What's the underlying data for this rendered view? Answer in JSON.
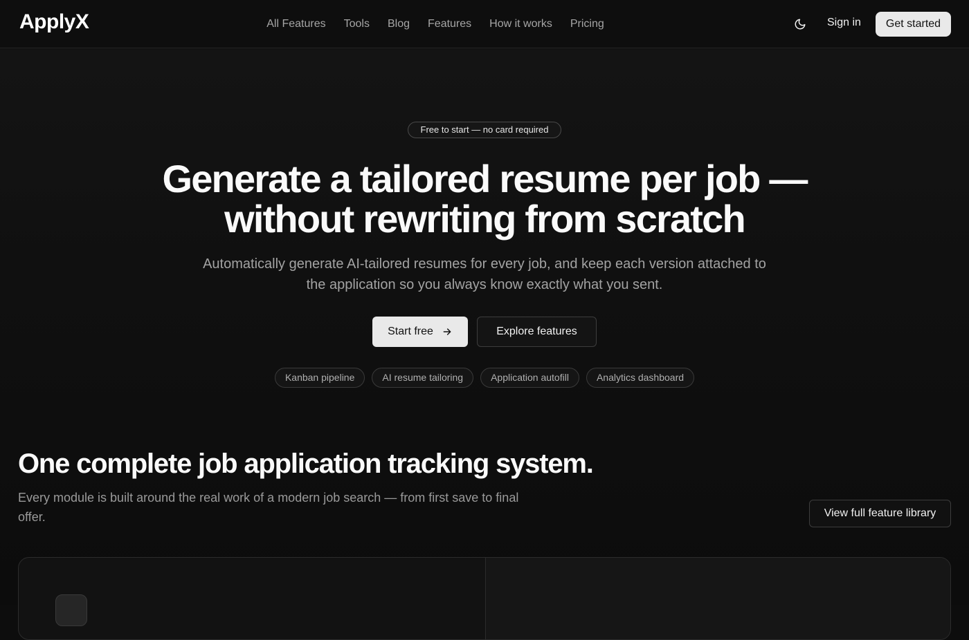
{
  "nav": {
    "logo": "ApplyX",
    "links": [
      "All Features",
      "Tools",
      "Blog",
      "Features",
      "How it works",
      "Pricing"
    ],
    "theme_icon": "moon-icon",
    "signin": "Sign in",
    "cta": "Get started"
  },
  "hero": {
    "badge": "Free to start — no card required",
    "title": "Generate a tailored resume per job — without rewriting from scratch",
    "subtitle": "Automatically generate AI-tailored resumes for every job, and keep each version attached to the application so you always know exactly what you sent.",
    "primary_cta": "Start free",
    "primary_icon": "arrow-right-icon",
    "secondary_cta": "Explore features",
    "pills": [
      "Kanban pipeline",
      "AI resume tailoring",
      "Application autofill",
      "Analytics dashboard"
    ]
  },
  "section": {
    "title": "One complete job application tracking system.",
    "subtitle": "Every module is built around the real work of a modern job search — from first save to final offer.",
    "cta": "View full feature library"
  },
  "colors": {
    "background": "#0d0d0d",
    "text": "#f2f2f2",
    "muted": "#a3a3a3",
    "button_light": "#e9e9e9"
  }
}
